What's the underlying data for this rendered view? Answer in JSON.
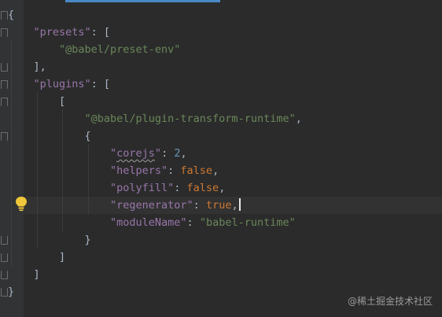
{
  "editor": {
    "lines": [
      {
        "indent": 0,
        "tokens": [
          {
            "t": "p",
            "v": "{"
          }
        ]
      },
      {
        "indent": 1,
        "tokens": [
          {
            "t": "key",
            "v": "\"presets\""
          },
          {
            "t": "p",
            "v": ": ["
          }
        ]
      },
      {
        "indent": 2,
        "tokens": [
          {
            "t": "str",
            "v": "\"@babel/preset-env\""
          }
        ]
      },
      {
        "indent": 1,
        "tokens": [
          {
            "t": "p",
            "v": "],"
          }
        ]
      },
      {
        "indent": 1,
        "tokens": [
          {
            "t": "key",
            "v": "\"plugins\""
          },
          {
            "t": "p",
            "v": ": ["
          }
        ]
      },
      {
        "indent": 2,
        "tokens": [
          {
            "t": "p",
            "v": "["
          }
        ]
      },
      {
        "indent": 3,
        "tokens": [
          {
            "t": "str",
            "v": "\"@babel/plugin-transform-runtime\""
          },
          {
            "t": "p",
            "v": ","
          }
        ]
      },
      {
        "indent": 3,
        "tokens": [
          {
            "t": "p",
            "v": "{"
          }
        ]
      },
      {
        "indent": 4,
        "tokens": [
          {
            "t": "key",
            "v": "\""
          },
          {
            "t": "key squiggle",
            "v": "corejs"
          },
          {
            "t": "key",
            "v": "\""
          },
          {
            "t": "p",
            "v": ": "
          },
          {
            "t": "num",
            "v": "2"
          },
          {
            "t": "p",
            "v": ","
          }
        ]
      },
      {
        "indent": 4,
        "tokens": [
          {
            "t": "key",
            "v": "\"helpers\""
          },
          {
            "t": "p",
            "v": ": "
          },
          {
            "t": "kw",
            "v": "false"
          },
          {
            "t": "p",
            "v": ","
          }
        ]
      },
      {
        "indent": 4,
        "tokens": [
          {
            "t": "key",
            "v": "\"polyfill\""
          },
          {
            "t": "p",
            "v": ": "
          },
          {
            "t": "kw",
            "v": "false"
          },
          {
            "t": "p",
            "v": ","
          }
        ]
      },
      {
        "indent": 4,
        "current": true,
        "tokens": [
          {
            "t": "key",
            "v": "\"regenerator\""
          },
          {
            "t": "p",
            "v": ": "
          },
          {
            "t": "kw",
            "v": "true"
          },
          {
            "t": "p",
            "v": ","
          }
        ]
      },
      {
        "indent": 4,
        "tokens": [
          {
            "t": "key",
            "v": "\"moduleName\""
          },
          {
            "t": "p",
            "v": ": "
          },
          {
            "t": "str",
            "v": "\"babel-runtime\""
          }
        ]
      },
      {
        "indent": 3,
        "tokens": [
          {
            "t": "p",
            "v": "}"
          }
        ]
      },
      {
        "indent": 2,
        "tokens": [
          {
            "t": "p",
            "v": "]"
          }
        ]
      },
      {
        "indent": 1,
        "tokens": [
          {
            "t": "p",
            "v": "]"
          }
        ]
      },
      {
        "indent": 0,
        "tokens": [
          {
            "t": "p",
            "v": "}"
          }
        ]
      }
    ]
  },
  "watermark": "@稀土掘金技术社区",
  "colors": {
    "background": "#2b2b2b",
    "key": "#9876aa",
    "string": "#6a8759",
    "number": "#6897bb",
    "keyword": "#cc7832",
    "punctuation": "#a9b7c6"
  },
  "icons": {
    "intention": "lightbulb-icon",
    "fold": "fold-marker-icon"
  }
}
